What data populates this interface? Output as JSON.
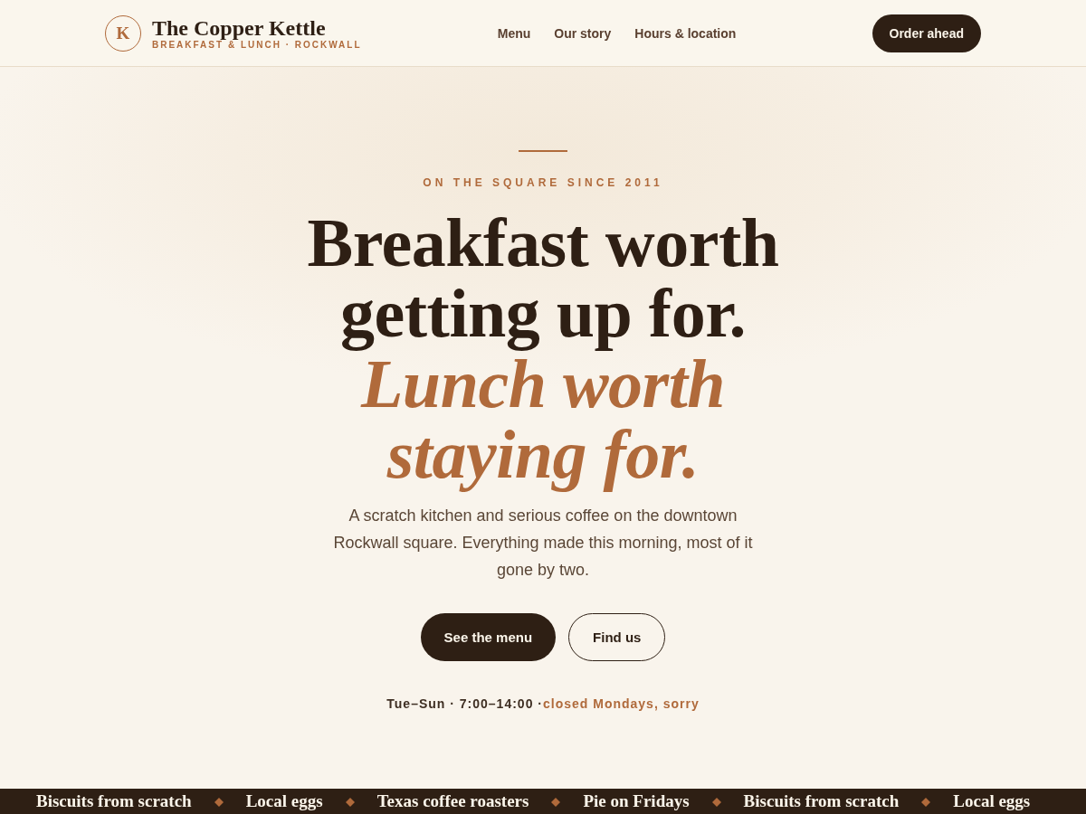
{
  "header": {
    "logo_letter": "K",
    "name": "The Copper Kettle",
    "tagline": "BREAKFAST & LUNCH · ROCKWALL",
    "nav": [
      "Menu",
      "Our story",
      "Hours & location"
    ],
    "cta": "Order ahead"
  },
  "hero": {
    "eyebrow": "ON THE SQUARE SINCE 2011",
    "headline": "Breakfast worth getting up for. *Lunch worth staying for.*",
    "intro": "A scratch kitchen and serious coffee on the downtown Rockwall square. Everything made this morning, most of it gone by two.",
    "buttons": [
      {
        "label": "See the menu",
        "kind": "primary"
      },
      {
        "label": "Find us",
        "kind": "outline"
      }
    ],
    "hours": "Tue–Sun · 7:00–14:00 ·",
    "note": "closed Mondays, sorry"
  },
  "ticker": [
    "Biscuits from scratch",
    "Local eggs",
    "Texas coffee roasters",
    "Pie on Fridays",
    "Biscuits from scratch",
    "Local eggs"
  ]
}
